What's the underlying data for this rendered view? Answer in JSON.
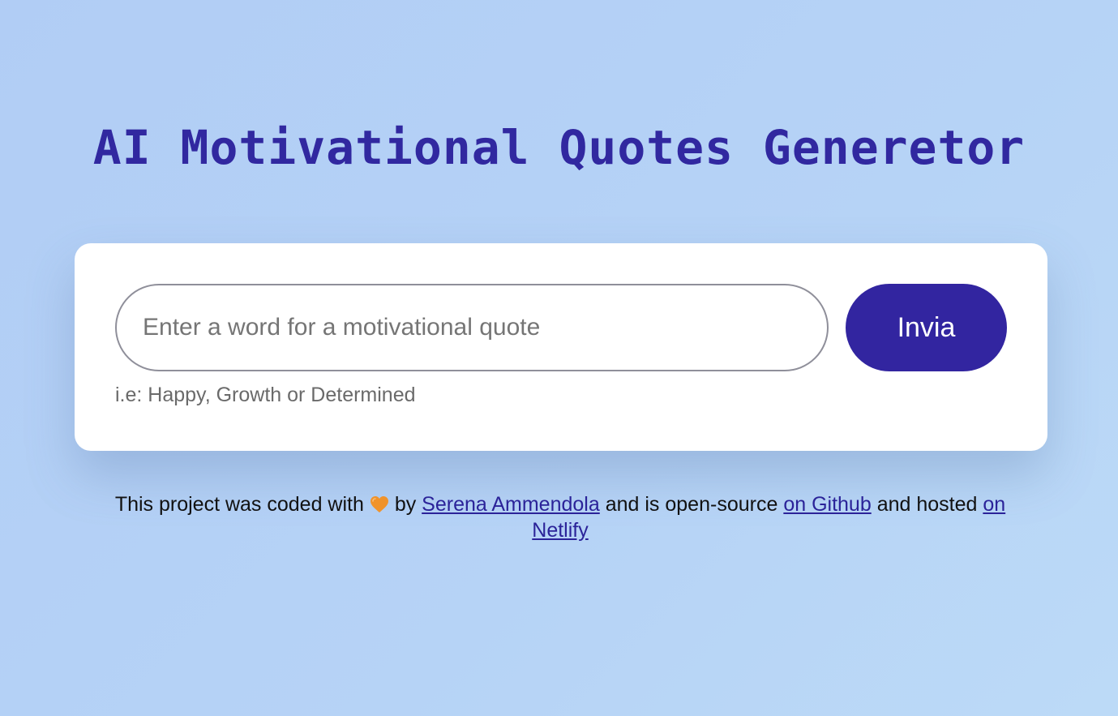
{
  "header": {
    "title": "AI Motivational Quotes Generetor"
  },
  "form": {
    "placeholder": "Enter a word for a motivational quote",
    "value": "",
    "submit_label": "Invia",
    "hint": "i.e: Happy, Growth or Determined"
  },
  "footer": {
    "text_1": "This project was coded with",
    "heart_icon": "orange-heart-icon",
    "text_2": "by",
    "author_link": "Serena Ammendola",
    "text_3": "and is open-source",
    "github_link": "on Github",
    "text_4": "and hosted",
    "netlify_link": "on Netlify"
  },
  "colors": {
    "background": "#b6d3f6",
    "accent": "#3225a0",
    "heart": "#f0932b"
  }
}
